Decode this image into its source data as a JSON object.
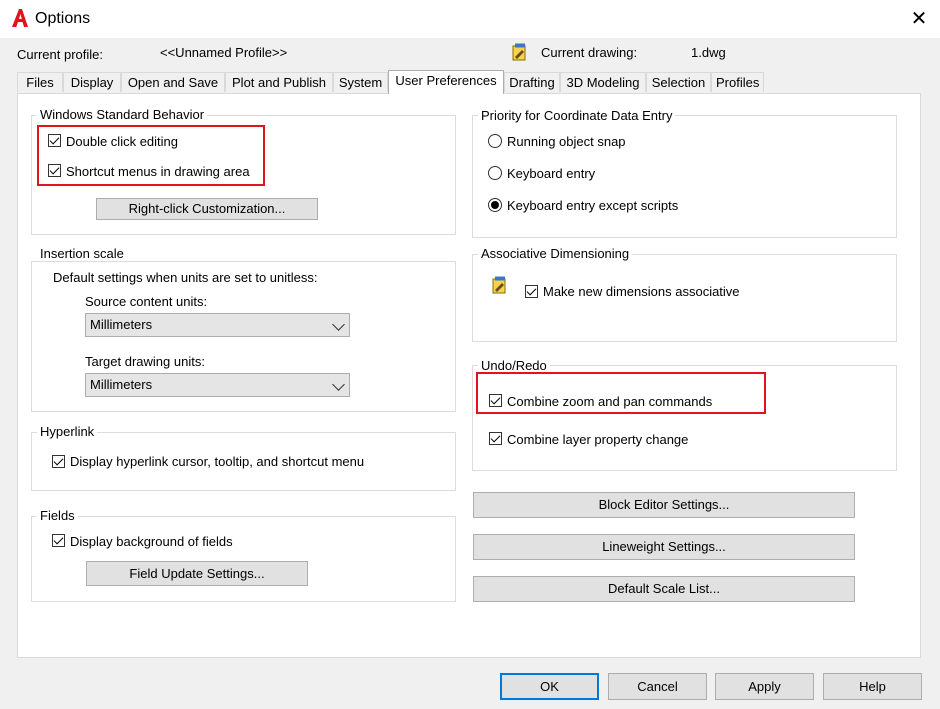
{
  "window": {
    "title": "Options"
  },
  "header": {
    "current_profile_label": "Current profile:",
    "current_profile_value": "<<Unnamed Profile>>",
    "current_drawing_label": "Current drawing:",
    "current_drawing_value": "1.dwg"
  },
  "tabs": [
    {
      "label": "Files"
    },
    {
      "label": "Display"
    },
    {
      "label": "Open and Save"
    },
    {
      "label": "Plot and Publish"
    },
    {
      "label": "System"
    },
    {
      "label": "User Preferences",
      "active": true
    },
    {
      "label": "Drafting"
    },
    {
      "label": "3D Modeling"
    },
    {
      "label": "Selection"
    },
    {
      "label": "Profiles"
    }
  ],
  "windows_behavior": {
    "title": "Windows Standard Behavior",
    "double_click": "Double click editing",
    "shortcut_menus": "Shortcut menus in drawing area",
    "right_click_button": "Right-click Customization..."
  },
  "insertion_scale": {
    "title": "Insertion scale",
    "description": "Default settings when units are set to unitless:",
    "source_label": "Source content units:",
    "source_value": "Millimeters",
    "target_label": "Target drawing units:",
    "target_value": "Millimeters"
  },
  "hyperlink": {
    "title": "Hyperlink",
    "display": "Display hyperlink cursor, tooltip, and shortcut menu"
  },
  "fields": {
    "title": "Fields",
    "display_bg": "Display background of fields",
    "update_button": "Field Update Settings..."
  },
  "priority": {
    "title": "Priority for Coordinate Data Entry",
    "running_snap": "Running object snap",
    "keyboard_entry": "Keyboard entry",
    "keyboard_except": "Keyboard entry except scripts",
    "selected": "Keyboard entry except scripts"
  },
  "assoc_dim": {
    "title": "Associative Dimensioning",
    "make_new": "Make new dimensions associative"
  },
  "undo_redo": {
    "title": "Undo/Redo",
    "combine_zoom": "Combine zoom and pan commands",
    "combine_layer": "Combine layer property change"
  },
  "right_buttons": {
    "block_editor": "Block Editor Settings...",
    "lineweight": "Lineweight Settings...",
    "default_scale": "Default Scale List..."
  },
  "footer": {
    "ok": "OK",
    "cancel": "Cancel",
    "apply": "Apply",
    "help": "Help"
  },
  "colors": {
    "highlight_box": "#e0141e",
    "default_button_border": "#0078d7",
    "app_icon": "#e0141e"
  },
  "icons": [
    "autocad-app-icon",
    "close-icon",
    "drawing-file-icon",
    "associative-dim-icon"
  ]
}
